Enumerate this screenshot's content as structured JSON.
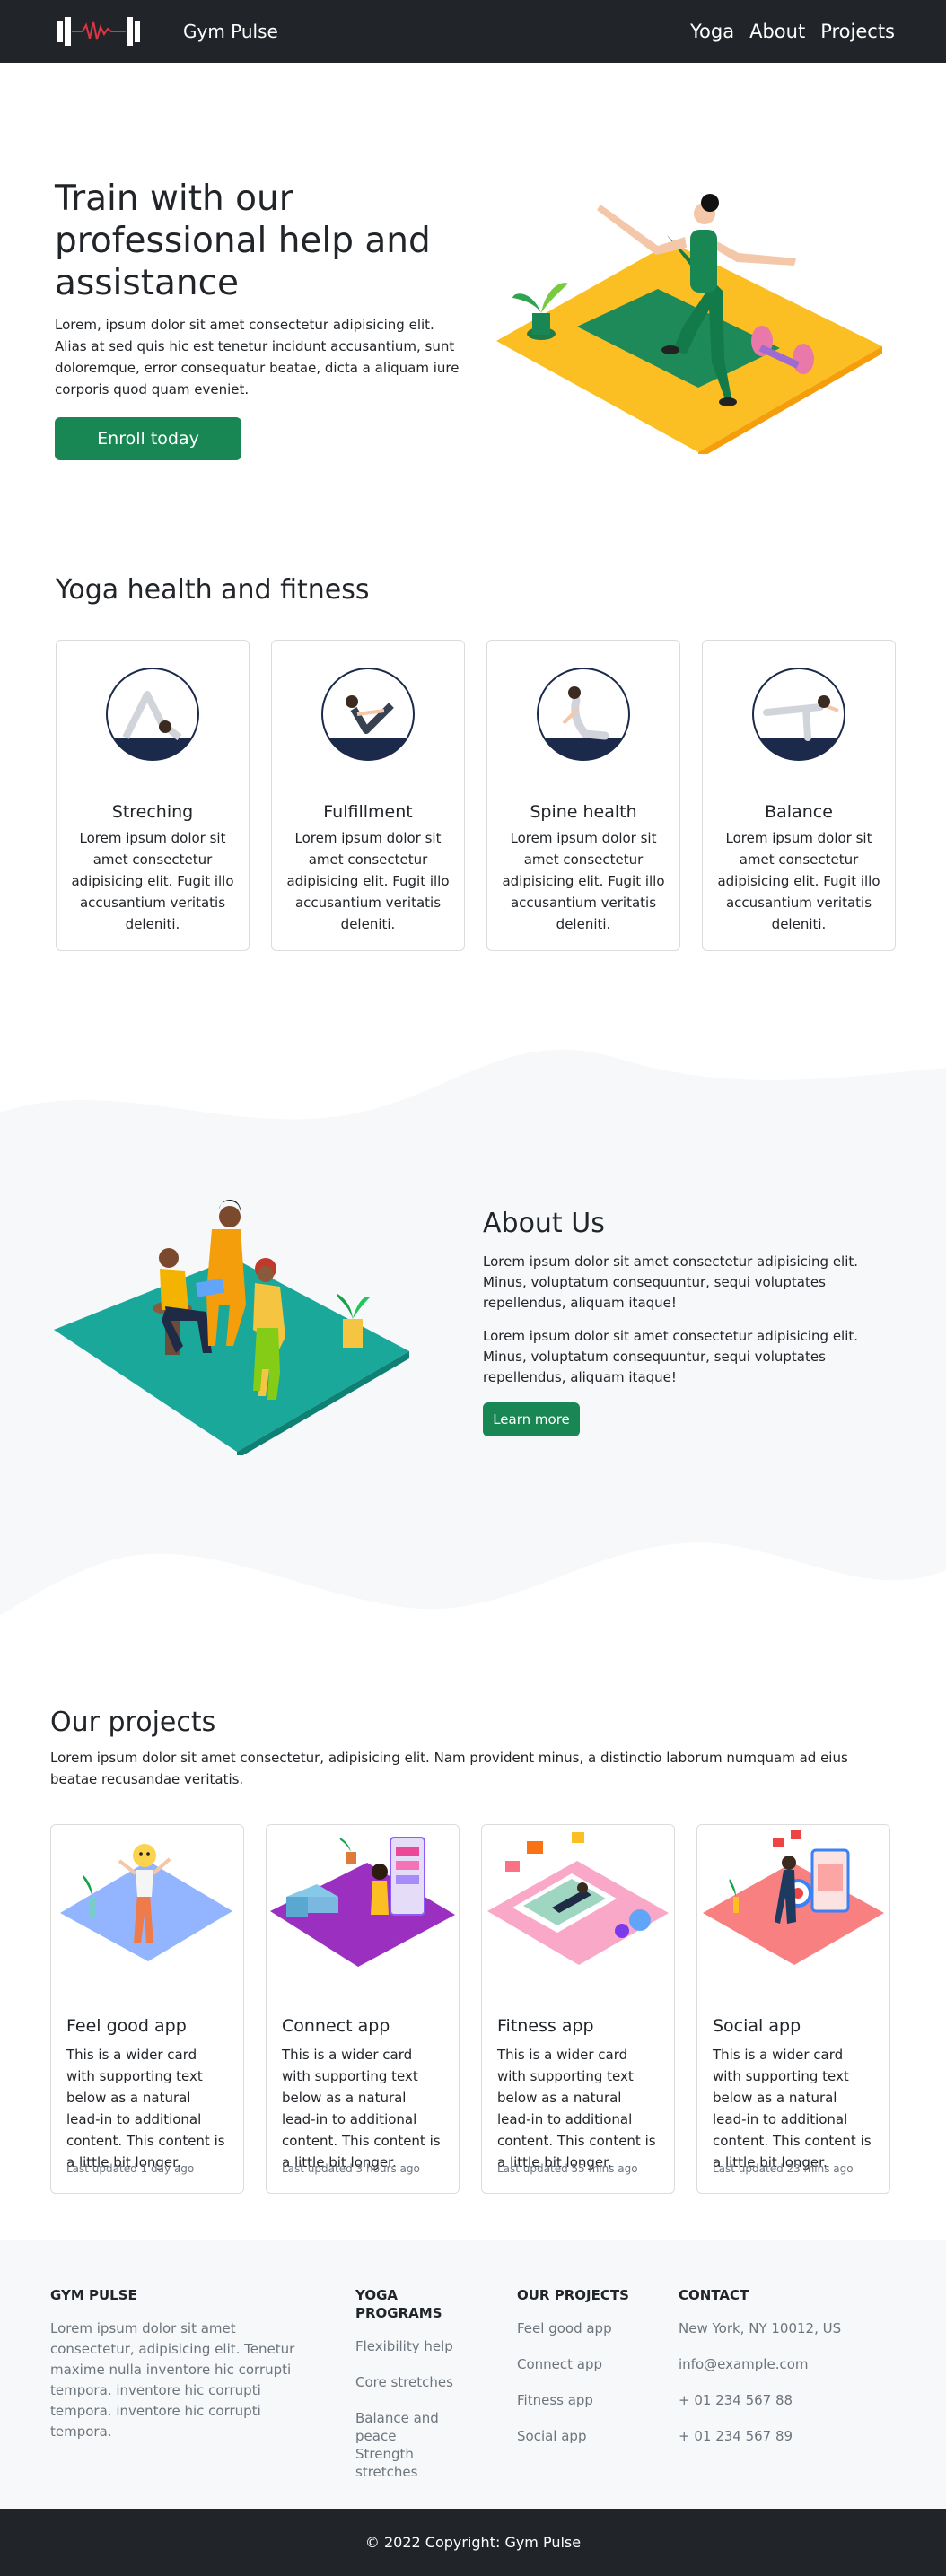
{
  "nav": {
    "brand": "Gym Pulse",
    "links": [
      "Yoga",
      "About",
      "Projects"
    ]
  },
  "hero": {
    "title": "Train with our professional help and assistance",
    "description": "Lorem, ipsum dolor sit amet consectetur adipisicing elit. Alias at sed quis hic est tenetur incidunt accusantium, sunt doloremque, error consequatur beatae, dicta a aliquam iure corporis quod quam eveniet.",
    "cta": "Enroll today"
  },
  "yoga": {
    "title": "Yoga health and fitness",
    "cards": [
      {
        "title": "Streching",
        "text": "Lorem ipsum dolor sit amet consectetur adipisicing elit. Fugit illo accusantium veritatis deleniti."
      },
      {
        "title": "Fulfillment",
        "text": "Lorem ipsum dolor sit amet consectetur adipisicing elit. Fugit illo accusantium veritatis deleniti."
      },
      {
        "title": "Spine health",
        "text": "Lorem ipsum dolor sit amet consectetur adipisicing elit. Fugit illo accusantium veritatis deleniti."
      },
      {
        "title": "Balance",
        "text": "Lorem ipsum dolor sit amet consectetur adipisicing elit. Fugit illo accusantium veritatis deleniti."
      }
    ]
  },
  "about": {
    "title": "About Us",
    "paragraphs": [
      "Lorem ipsum dolor sit amet consectetur adipisicing elit. Minus, voluptatum consequuntur, sequi voluptates repellendus, aliquam itaque!",
      "Lorem ipsum dolor sit amet consectetur adipisicing elit. Minus, voluptatum consequuntur, sequi voluptates repellendus, aliquam itaque!"
    ],
    "button": "Learn more"
  },
  "projects": {
    "title": "Our projects",
    "description": "Lorem ipsum dolor sit amet consectetur, adipisicing elit. Nam provident minus, a distinctio laborum numquam ad eius beatae recusandae veritatis.",
    "cards": [
      {
        "title": "Feel good app",
        "text": "This is a wider card with supporting text below as a natural lead-in to additional content. This content is a little bit longer.",
        "updated": "Last updated 1 day ago"
      },
      {
        "title": "Connect app",
        "text": "This is a wider card with supporting text below as a natural lead-in to additional content. This content is a little bit longer.",
        "updated": "Last updated 3 hours ago"
      },
      {
        "title": "Fitness app",
        "text": "This is a wider card with supporting text below as a natural lead-in to additional content. This content is a little bit longer.",
        "updated": "Last updated 55 mins ago"
      },
      {
        "title": "Social app",
        "text": "This is a wider card with supporting text below as a natural lead-in to additional content. This content is a little bit longer.",
        "updated": "Last updated 23 mins ago"
      }
    ]
  },
  "footer": {
    "about_heading": "GYM PULSE",
    "about_text": "Lorem ipsum dolor sit amet consectetur, adipisicing elit. Tenetur maxime nulla inventore hic corrupti tempora. inventore hic corrupti tempora. inventore hic corrupti tempora.",
    "programs_heading": "YOGA PROGRAMS",
    "programs": [
      "Flexibility help",
      "Core stretches",
      "Balance and peace",
      "Strength stretches"
    ],
    "projects_heading": "OUR PROJECTS",
    "projects": [
      "Feel good app",
      "Connect app",
      "Fitness app",
      "Social app"
    ],
    "contact_heading": "CONTACT",
    "contact": [
      "New York, NY 10012, US",
      "info@example.com",
      "+ 01 234 567 88",
      "+ 01 234 567 89"
    ],
    "copyright": "© 2022 Copyright: Gym Pulse"
  },
  "colors": {
    "nav_bg": "#212529",
    "accent_green": "#198754",
    "section_bg": "#f7f8fa",
    "muted_text": "#6c757d"
  }
}
